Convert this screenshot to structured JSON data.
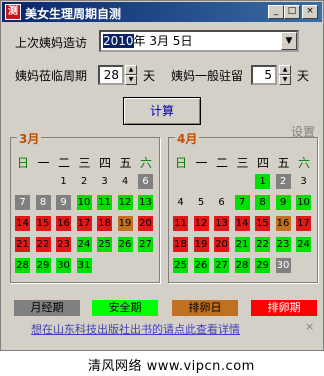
{
  "window": {
    "title": "美女生理周期自测",
    "app_icon": "测",
    "min": "_",
    "max": "□",
    "close": "×"
  },
  "form": {
    "last_visit_label": "上次姨妈造访",
    "date_year": "2010",
    "date_rest": "年  3月  5日",
    "cycle_label": "姨妈莅临周期",
    "cycle_value": "28",
    "cycle_unit": "天",
    "stay_label": "姨妈一般驻留",
    "stay_value": "5",
    "stay_unit": "天"
  },
  "calc_button": "计算",
  "settings_link": "设置",
  "weekdays": [
    "日",
    "一",
    "二",
    "三",
    "四",
    "五",
    "六"
  ],
  "weekday_colors": [
    "#008000",
    "#000000",
    "#000000",
    "#000000",
    "#000000",
    "#000000",
    "#008000"
  ],
  "months": [
    {
      "title": "3月",
      "days": [
        {
          "n": "1",
          "c": "plain",
          "col": 2,
          "row": 0
        },
        {
          "n": "2",
          "c": "plain",
          "col": 3,
          "row": 0
        },
        {
          "n": "3",
          "c": "plain",
          "col": 4,
          "row": 0
        },
        {
          "n": "4",
          "c": "plain",
          "col": 5,
          "row": 0
        },
        {
          "n": "5",
          "c": "gray",
          "col": 5,
          "row": 0
        },
        {
          "n": "6",
          "c": "gray",
          "col": 6,
          "row": 0
        },
        {
          "n": "7",
          "c": "gray",
          "col": 0,
          "row": 1
        },
        {
          "n": "8",
          "c": "gray",
          "col": 1,
          "row": 1
        },
        {
          "n": "9",
          "c": "gray",
          "col": 2,
          "row": 1
        },
        {
          "n": "10",
          "c": "green",
          "col": 3,
          "row": 1
        },
        {
          "n": "11",
          "c": "green",
          "col": 4,
          "row": 1
        },
        {
          "n": "12",
          "c": "green",
          "col": 5,
          "row": 1
        },
        {
          "n": "13",
          "c": "green",
          "col": 6,
          "row": 1
        },
        {
          "n": "14",
          "c": "red",
          "col": 0,
          "row": 2
        },
        {
          "n": "15",
          "c": "red",
          "col": 1,
          "row": 2
        },
        {
          "n": "16",
          "c": "red",
          "col": 2,
          "row": 2
        },
        {
          "n": "17",
          "c": "red",
          "col": 3,
          "row": 2
        },
        {
          "n": "18",
          "c": "red",
          "col": 4,
          "row": 2
        },
        {
          "n": "19",
          "c": "orange",
          "col": 5,
          "row": 2
        },
        {
          "n": "20",
          "c": "red",
          "col": 6,
          "row": 2
        },
        {
          "n": "21",
          "c": "red",
          "col": 0,
          "row": 3
        },
        {
          "n": "22",
          "c": "red",
          "col": 1,
          "row": 3
        },
        {
          "n": "23",
          "c": "red",
          "col": 2,
          "row": 3
        },
        {
          "n": "24",
          "c": "green",
          "col": 3,
          "row": 3
        },
        {
          "n": "25",
          "c": "green",
          "col": 4,
          "row": 3
        },
        {
          "n": "26",
          "c": "green",
          "col": 5,
          "row": 3
        },
        {
          "n": "27",
          "c": "green",
          "col": 6,
          "row": 3
        },
        {
          "n": "28",
          "c": "green",
          "col": 0,
          "row": 4
        },
        {
          "n": "29",
          "c": "green",
          "col": 1,
          "row": 4
        },
        {
          "n": "30",
          "c": "green",
          "col": 2,
          "row": 4
        },
        {
          "n": "31",
          "c": "green",
          "col": 3,
          "row": 4
        }
      ]
    },
    {
      "title": "4月",
      "days": [
        {
          "n": "1",
          "c": "green",
          "col": 4,
          "row": 0
        },
        {
          "n": "2",
          "c": "gray",
          "col": 5,
          "row": 0
        },
        {
          "n": "3",
          "c": "plain",
          "col": 6,
          "row": 0
        },
        {
          "n": "4",
          "c": "plain",
          "col": 0,
          "row": 1
        },
        {
          "n": "5",
          "c": "plain",
          "col": 1,
          "row": 1
        },
        {
          "n": "6",
          "c": "plain",
          "col": 2,
          "row": 1
        },
        {
          "n": "7",
          "c": "green",
          "col": 3,
          "row": 1
        },
        {
          "n": "8",
          "c": "green",
          "col": 4,
          "row": 1
        },
        {
          "n": "9",
          "c": "green",
          "col": 5,
          "row": 1
        },
        {
          "n": "10",
          "c": "green",
          "col": 6,
          "row": 1
        },
        {
          "n": "11",
          "c": "red",
          "col": 0,
          "row": 2
        },
        {
          "n": "12",
          "c": "red",
          "col": 1,
          "row": 2
        },
        {
          "n": "13",
          "c": "red",
          "col": 2,
          "row": 2
        },
        {
          "n": "14",
          "c": "red",
          "col": 3,
          "row": 2
        },
        {
          "n": "15",
          "c": "red",
          "col": 4,
          "row": 2
        },
        {
          "n": "16",
          "c": "orange",
          "col": 5,
          "row": 2
        },
        {
          "n": "17",
          "c": "red",
          "col": 6,
          "row": 2
        },
        {
          "n": "18",
          "c": "red",
          "col": 0,
          "row": 3
        },
        {
          "n": "19",
          "c": "red",
          "col": 1,
          "row": 3
        },
        {
          "n": "20",
          "c": "red",
          "col": 2,
          "row": 3
        },
        {
          "n": "21",
          "c": "green",
          "col": 3,
          "row": 3
        },
        {
          "n": "22",
          "c": "green",
          "col": 4,
          "row": 3
        },
        {
          "n": "23",
          "c": "green",
          "col": 5,
          "row": 3
        },
        {
          "n": "24",
          "c": "green",
          "col": 6,
          "row": 3
        },
        {
          "n": "25",
          "c": "green",
          "col": 0,
          "row": 4
        },
        {
          "n": "26",
          "c": "green",
          "col": 1,
          "row": 4
        },
        {
          "n": "27",
          "c": "green",
          "col": 2,
          "row": 4
        },
        {
          "n": "28",
          "c": "green",
          "col": 3,
          "row": 4
        },
        {
          "n": "29",
          "c": "green",
          "col": 4,
          "row": 4
        },
        {
          "n": "30",
          "c": "gray",
          "col": 5,
          "row": 4
        }
      ]
    }
  ],
  "legend": [
    {
      "label": "月经期",
      "color": "#808080",
      "text_color": "#000000"
    },
    {
      "label": "安全期",
      "color": "#00ff00",
      "text_color": "#000000"
    },
    {
      "label": "排卵日",
      "color": "#c07020",
      "text_color": "#000000"
    },
    {
      "label": "排卵期",
      "color": "#ff0000",
      "text_color": "#ffffff"
    }
  ],
  "promo": {
    "link": "想在山东科技出版社出书的请点此查看详情",
    "close": "×"
  },
  "watermark": {
    "text": "清风网络  www.vipcn.com"
  }
}
